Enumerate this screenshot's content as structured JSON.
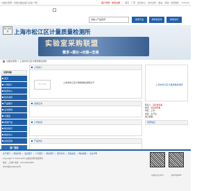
{
  "topbar": {
    "left_text": "仪器交易网 - 中国仪器设备行业第一网！",
    "links": [
      "客户登录",
      "免费注册",
      "首页",
      "厂家",
      "新闻中心",
      "技术资料",
      "展会",
      "商铺",
      "搜索服务",
      "TOP100"
    ]
  },
  "search": {
    "placeholder": "请输入产品名称",
    "btn_product": "搜索产品",
    "btn_supplier": "搜索供应商",
    "btn_news": "搜索资讯"
  },
  "banner": {
    "logo_text": "第三方检测",
    "title": "上海市松江区计量质量检测所",
    "slogan": "实验室采购联盟",
    "tagline": "需求→报价→对接→交易"
  },
  "breadcrumb": "仪器交易网 > 上海市松江区计量质量检测所",
  "leftnav": {
    "header": "全部导航",
    "items": [
      "首页",
      "公司简介",
      "新闻中心",
      "技术资料",
      "产品展示",
      "证书荣誉",
      "大展会",
      "促销产品",
      "联系我们",
      "留言中心",
      "在线咨询"
    ],
    "footer": "商厂服务"
  },
  "main": {
    "sections": [
      "公司简介",
      "资质证书",
      "公司新闻",
      "产品列表"
    ],
    "no_logo": "NO LOGO",
    "intro": "上海市松江区计量质量检测所位于"
  },
  "right": {
    "company": "上海市松江区计量质量检测所",
    "contact_label": "联系人：",
    "contact_value": "请点击查看",
    "tel_label": "电话：",
    "tel_value": "请点击查看",
    "region": "地区：上海",
    "type": "类型：生产商",
    "email": "电子邮箱：",
    "more_head": "商家信息"
  },
  "footer": {
    "links": [
      "关于我们",
      "网站导航",
      "会员服务",
      "广告服务",
      "联系我们",
      "服务条款",
      "隐私政策",
      "网站地图",
      "免责声明"
    ],
    "line1": "Copyright © 2019-2025 仪器交易网 版权所有",
    "line2": "地址：上海市 电话：021-00000000",
    "line3": "沪ICP备00000000号",
    "qr1_caption": "扫码关注公众号",
    "qr2_caption": "扫码下载APP"
  }
}
